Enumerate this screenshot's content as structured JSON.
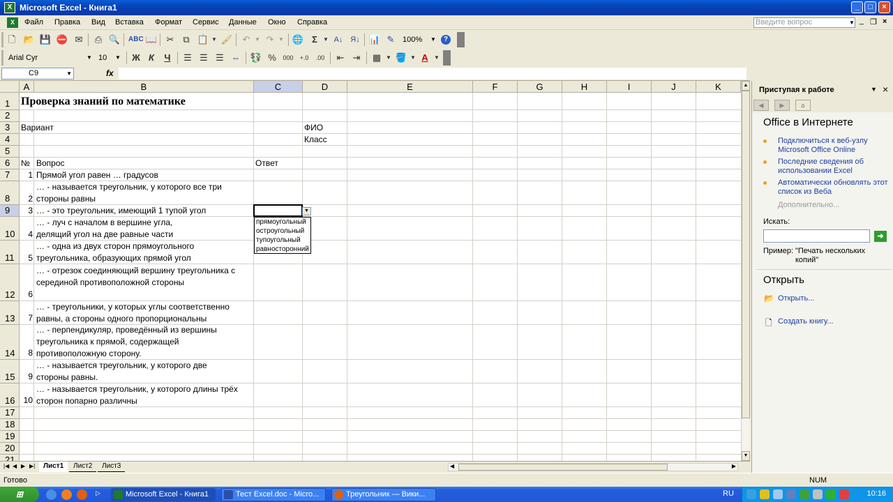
{
  "window": {
    "title": "Microsoft Excel - Книга1"
  },
  "menu": {
    "items": [
      "Файл",
      "Правка",
      "Вид",
      "Вставка",
      "Формат",
      "Сервис",
      "Данные",
      "Окно",
      "Справка"
    ],
    "help_placeholder": "Введите вопрос"
  },
  "toolbar": {
    "zoom": "100%",
    "sum": "Σ"
  },
  "format_toolbar": {
    "font": "Arial Cyr",
    "size": "10",
    "bold": "Ж",
    "italic": "К",
    "underline": "Ч",
    "percent": "%"
  },
  "formula_bar": {
    "name_box": "C9",
    "fx": "fx",
    "content": ""
  },
  "columns": [
    "A",
    "B",
    "C",
    "D",
    "E",
    "F",
    "G",
    "H",
    "I",
    "J",
    "K"
  ],
  "rows": [
    "1",
    "2",
    "3",
    "4",
    "5",
    "6",
    "7",
    "8",
    "9",
    "10",
    "11",
    "12",
    "13",
    "14",
    "15",
    "16",
    "17",
    "18",
    "19",
    "20",
    "21"
  ],
  "cells": {
    "title": "Проверка знаний по математике",
    "variant": "Вариант",
    "fio": "ФИО",
    "klass": "Класс",
    "num_header": "№",
    "question_header": "Вопрос",
    "answer_header": "Ответ",
    "questions": [
      {
        "n": "1",
        "text": "Прямой угол равен … градусов"
      },
      {
        "n": "2",
        "text": "… - называется треугольник, у которого все три стороны равны"
      },
      {
        "n": "3",
        "text": "… - это треугольник, имеющий 1 тупой угол"
      },
      {
        "n": "4",
        "text": "… - луч с началом в вершине угла, делящий угол на две равные части"
      },
      {
        "n": "5",
        "text": "… - одна из двух сторон прямоугольного треугольника, образующих прямой угол"
      },
      {
        "n": "6",
        "text": "… - отрезок соединяющий вершину треугольника с серединой противоположной стороны"
      },
      {
        "n": "7",
        "text": "… - треугольники, у которых углы соответственно равны, а стороны одного пропорциональны"
      },
      {
        "n": "8",
        "text": "… - перпендикуляр, проведённый из вершины треугольника к прямой, содержащей противоположную сторону."
      },
      {
        "n": "9",
        "text": "… - называется треугольник, у которого две стороны равны."
      },
      {
        "n": "10",
        "text": "… - называется треугольник, у которого длины трёх сторон попарно различны"
      }
    ]
  },
  "dropdown": {
    "options": [
      "прямоугольный",
      "остроугольный",
      "тупоугольный",
      "равносторонний"
    ]
  },
  "sheet_tabs": [
    "Лист1",
    "Лист2",
    "Лист3"
  ],
  "status": {
    "left": "Готово",
    "num": "NUM"
  },
  "task_pane": {
    "title": "Приступая к работе",
    "section1": "Office в Интернете",
    "links": [
      "Подключиться к веб-узлу Microsoft Office Online",
      "Последние сведения об использовании Excel",
      "Автоматически обновлять этот список из Веба"
    ],
    "more": "Дополнительно...",
    "search_label": "Искать:",
    "example_label": "Пример:",
    "example_text": "\"Печать нескольких копий\"",
    "section2": "Открыть",
    "open_link": "Открыть...",
    "create_link": "Создать книгу..."
  },
  "taskbar": {
    "tasks": [
      "Microsoft Excel - Книга1",
      "Тест Excel.doc - Micro...",
      "Треугольник — Вики..."
    ],
    "lang": "RU",
    "clock": "10:16"
  }
}
